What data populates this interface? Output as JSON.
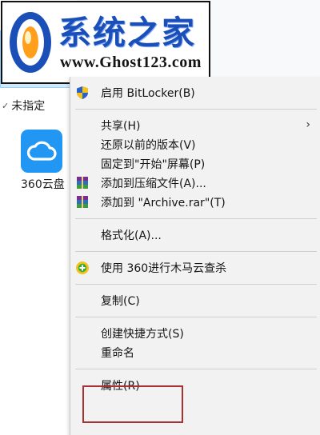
{
  "watermark": {
    "title": "系统之家",
    "url": "www.Ghost123.com"
  },
  "explorer": {
    "group_label": "未指定",
    "items": [
      {
        "label": "360云盘",
        "icon": "cloud-icon",
        "color": "#2196f3"
      }
    ]
  },
  "context_menu": {
    "bitlocker": {
      "label": "启用 BitLocker(B)",
      "icon": "shield-icon"
    },
    "share": {
      "label": "共享(H)",
      "submenu_icon": "chevron-right-icon"
    },
    "restore": {
      "label": "还原以前的版本(V)"
    },
    "pin_start": {
      "label": "固定到\"开始\"屏幕(P)"
    },
    "add_archive": {
      "label": "添加到压缩文件(A)...",
      "icon": "winrar-icon"
    },
    "add_rar": {
      "label": "添加到 \"Archive.rar\"(T)",
      "icon": "winrar-icon"
    },
    "format": {
      "label": "格式化(A)..."
    },
    "scan_360": {
      "label": "使用 360进行木马云查杀",
      "icon": "360-scan-icon"
    },
    "copy": {
      "label": "复制(C)"
    },
    "create_shortcut": {
      "label": "创建快捷方式(S)"
    },
    "rename": {
      "label": "重命名"
    },
    "properties": {
      "label": "属性(R)"
    }
  },
  "colors": {
    "selection": "#cde8ff",
    "highlight_border": "#a83232",
    "logo_blue": "#1b4fb8"
  }
}
